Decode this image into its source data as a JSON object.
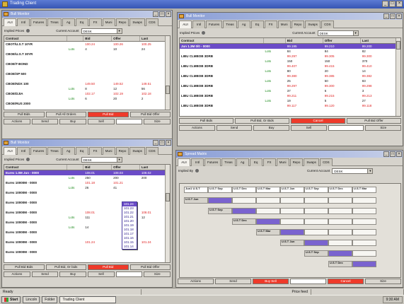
{
  "app": {
    "title": "Trading Client"
  },
  "status": {
    "left": "Ready",
    "middle": "Price feed",
    "right": ""
  },
  "taskbar": {
    "start": "Start",
    "items": [
      "Lincoln",
      "Folder",
      "Trading Client"
    ],
    "clock": "9:30 AM"
  },
  "win1": {
    "title": "Bull Monitor",
    "tabs": [
      "AUI",
      "Intl",
      "Futures",
      "Treas",
      "Ag",
      "Eq",
      "FX",
      "Muni",
      "Repo",
      "Swaps",
      "CDS"
    ],
    "implied_label": "Implied Prices",
    "account_label": "Current Account",
    "account_value": "DESK",
    "columns": [
      "Contract",
      "",
      "Bid",
      "Offer",
      "Last"
    ],
    "rows": [
      {
        "c": "CBOT/U.S.T 10YR",
        "q": "",
        "bid": "100.24",
        "offer": "100.26",
        "last": "100.25",
        "cls": "c-red"
      },
      {
        "c": "",
        "q": "Lots",
        "bid": "4",
        "offer": "10",
        "last": "24",
        "cls": ""
      },
      {
        "c": "CBOE/U.S.T 30YR",
        "q": "",
        "bid": "",
        "offer": "",
        "last": "",
        "cls": ""
      },
      {
        "c": "",
        "q": "",
        "bid": "",
        "offer": "",
        "last": "",
        "cls": ""
      },
      {
        "c": "CBOE/T-BOND",
        "q": "",
        "bid": "",
        "offer": "",
        "last": "",
        "cls": ""
      },
      {
        "c": "",
        "q": "",
        "bid": "",
        "offer": "",
        "last": "",
        "cls": ""
      },
      {
        "c": "CBOE/SP 500",
        "q": "",
        "bid": "",
        "offer": "",
        "last": "",
        "cls": ""
      },
      {
        "c": "",
        "q": "",
        "bid": "",
        "offer": "",
        "last": "",
        "cls": ""
      },
      {
        "c": "CBOE/NDX 100",
        "q": "",
        "bid": "149.50",
        "offer": "149.52",
        "last": "149.51",
        "cls": "c-red"
      },
      {
        "c": "",
        "q": "Lots",
        "bid": "8",
        "offer": "12",
        "last": "56",
        "cls": ""
      },
      {
        "c": "CBOE/DJIA",
        "q": "",
        "bid": "102.17",
        "offer": "102.19",
        "last": "102.18",
        "cls": "c-red"
      },
      {
        "c": "",
        "q": "Lots",
        "bid": "6",
        "offer": "20",
        "last": "2",
        "cls": ""
      },
      {
        "c": "CBOE/RUS 2000",
        "q": "",
        "bid": "",
        "offer": "",
        "last": "",
        "cls": ""
      }
    ],
    "footer1": [
      "Pull Bids",
      "Pull All Orders",
      "Pull Bid",
      "Pull Bid Offer"
    ],
    "footer2": [
      "Actions",
      "Send",
      "Buy",
      "Sell",
      "",
      "Size"
    ]
  },
  "win2": {
    "title": "Bull Monitor",
    "tabs": [
      "AUI",
      "Intl",
      "Futures",
      "Treas",
      "Ag",
      "Eq",
      "FX",
      "Muni",
      "Repo",
      "Swaps",
      "CDS"
    ],
    "implied_label": "Implied Prices",
    "account_label": "Current Account",
    "account_value": "DESK",
    "columns": [
      "Contract",
      "",
      "Bid",
      "Offer",
      "Last"
    ],
    "rows": [
      {
        "c": "Jun 1.3M 0/0 - 0000",
        "q": "",
        "bid": "99.195",
        "offer": "99.210",
        "last": "99.200",
        "cls": "sel"
      },
      {
        "c": "",
        "q": "Lots",
        "bid": "84",
        "offer": "84",
        "last": "82",
        "cls": ""
      },
      {
        "c": "LIBU CLMBOB 3DRB",
        "q": "",
        "bid": "99.297",
        "offer": "99.305",
        "last": "99.300",
        "cls": "c-red"
      },
      {
        "c": "",
        "q": "Lots",
        "bid": "150",
        "offer": "150",
        "last": "370",
        "cls": ""
      },
      {
        "c": "LIBU CLMBOB 3DRB",
        "q": "",
        "bid": "99.407",
        "offer": "99.415",
        "last": "99.410",
        "cls": "c-red"
      },
      {
        "c": "",
        "q": "Lots",
        "bid": "80",
        "offer": "20",
        "last": "14",
        "cls": ""
      },
      {
        "c": "LIBU CLMBOB 3DRB",
        "q": "",
        "bid": "99.380",
        "offer": "99.385",
        "last": "99.382",
        "cls": "c-red"
      },
      {
        "c": "",
        "q": "Lots",
        "bid": "25",
        "offer": "50",
        "last": "83",
        "cls": ""
      },
      {
        "c": "LIBU CLMBOB 3DRB",
        "q": "",
        "bid": "99.297",
        "offer": "99.300",
        "last": "99.298",
        "cls": "c-red"
      },
      {
        "c": "",
        "q": "Lots",
        "bid": "37",
        "offer": "6",
        "last": "3",
        "cls": ""
      },
      {
        "c": "LIBU CLMBOB 3DRB",
        "q": "",
        "bid": "99.211",
        "offer": "99.215",
        "last": "99.213",
        "cls": "c-red"
      },
      {
        "c": "",
        "q": "Lots",
        "bid": "19",
        "offer": "5",
        "last": "27",
        "cls": ""
      },
      {
        "c": "LIBU CLMBOB 3DRB",
        "q": "",
        "bid": "99.117",
        "offer": "99.120",
        "last": "99.118",
        "cls": "c-red"
      }
    ],
    "footer1": [
      "Pull Bids",
      "Pull Bid, Or Bids",
      "Cancel",
      "Pull Bid Offer"
    ],
    "footer2": [
      "Actions",
      "Send",
      "Buy",
      "Sell",
      "",
      "Size"
    ]
  },
  "win3": {
    "title": "Bull Monitor",
    "tabs": [
      "AUI",
      "Intl",
      "Futures",
      "Treas",
      "Ag",
      "Eq",
      "FX",
      "Muni",
      "Repo",
      "Swaps",
      "CDS"
    ],
    "implied_label": "Implied Prices",
    "account_label": "Current Account",
    "account_value": "DESK",
    "columns": [
      "Contract",
      "",
      "Bid",
      "Offer",
      "Last"
    ],
    "rows": [
      {
        "c": "Eurex 1.0M Jun - 0000",
        "q": "",
        "bid": "108.01",
        "offer": "108.03",
        "last": "108.02",
        "cls": "sel"
      },
      {
        "c": "",
        "q": "Lots",
        "bid": "250",
        "offer": "200",
        "last": "200",
        "cls": ""
      },
      {
        "c": "Eurex 10000M - 0000",
        "q": "",
        "bid": "101.18",
        "offer": "101.21",
        "last": "",
        "cls": "c-red"
      },
      {
        "c": "",
        "q": "Lots",
        "bid": "26",
        "offer": "41",
        "last": "",
        "cls": ""
      },
      {
        "c": "Eurex 10000M - 0000",
        "q": "",
        "bid": "",
        "offer": "",
        "last": "",
        "cls": ""
      },
      {
        "c": "",
        "q": "",
        "bid": "",
        "offer": "",
        "last": "",
        "cls": ""
      },
      {
        "c": "Eurex 10000M - 0000",
        "q": "",
        "bid": "",
        "offer": "",
        "last": "",
        "cls": ""
      },
      {
        "c": "",
        "q": "",
        "bid": "",
        "offer": "",
        "last": "",
        "cls": ""
      },
      {
        "c": "Eurex 10000M - 0000",
        "q": "",
        "bid": "108.01",
        "offer": "",
        "last": "108.01",
        "cls": "c-red"
      },
      {
        "c": "",
        "q": "Lots",
        "bid": "111",
        "offer": "",
        "last": "12",
        "cls": ""
      },
      {
        "c": "Eurex 10000M - 0000",
        "q": "",
        "bid": "",
        "offer": "",
        "last": "",
        "cls": ""
      },
      {
        "c": "",
        "q": "Lots",
        "bid": "14",
        "offer": "",
        "last": "",
        "cls": ""
      },
      {
        "c": "Eurex 10000M - 0000",
        "q": "",
        "bid": "",
        "offer": "",
        "last": "",
        "cls": ""
      },
      {
        "c": "",
        "q": "",
        "bid": "",
        "offer": "",
        "last": "",
        "cls": ""
      },
      {
        "c": "Eurex 10000M - 0000",
        "q": "",
        "bid": "101.24",
        "offer": "",
        "last": "101.24",
        "cls": "c-red"
      },
      {
        "c": "",
        "q": "",
        "bid": "",
        "offer": "",
        "last": "",
        "cls": ""
      },
      {
        "c": "Eurex 10000M - 0000",
        "q": "",
        "bid": "",
        "offer": "",
        "last": "",
        "cls": ""
      }
    ],
    "dropdown": [
      "101.24",
      "101.23",
      "101.22",
      "101.21",
      "101.20",
      "101.19",
      "101.18",
      "101.17",
      "101.16",
      "101.15",
      "101.14"
    ],
    "footer1": [
      "Pull Bid Bids",
      "Pull Bid, Or bids",
      "Pull Bid",
      "Pull Bid Offer"
    ],
    "footer2": [
      "Actions",
      "Send",
      "Buy",
      "Sell",
      "",
      "Size"
    ]
  },
  "win4": {
    "title": "Spread Matrix",
    "tabs": [
      "AUI",
      "Intl",
      "Futures",
      "Treas",
      "Ag",
      "Eq",
      "FX",
      "Muni",
      "Repo",
      "Swaps",
      "CDS"
    ],
    "implied_label": "Implied By",
    "account_label": "Current Account",
    "account_value": "DESK",
    "col_headers": [
      "Jun1 U.S.T",
      "U.S.T Sep",
      "U.S.T Dec",
      "U.S.T Mar",
      "U.S.T Jun",
      "U.S.T Sep",
      "U.S.T Dec",
      "U.S.T Mar"
    ],
    "row_headers": [
      "U.S.T Jun",
      "U.S.T Sep",
      "U.S.T Dec",
      "U.S.T Mar",
      "U.S.T Jun",
      "U.S.T Sep",
      "U.S.T Dec"
    ],
    "cells": [
      [
        "+0.00",
        "",
        "",
        "",
        "",
        "",
        "",
        ""
      ],
      [
        "+0.05",
        "+0.12",
        "",
        "",
        "",
        "",
        "",
        ""
      ],
      [
        "+0.10",
        "+0.15",
        "+0.18",
        "",
        "",
        "",
        "",
        ""
      ],
      [
        "+0.14",
        "+0.20",
        "+0.24",
        "+0.26",
        "",
        "",
        "",
        ""
      ],
      [
        "+0.18",
        "+0.25",
        "+0.30",
        "+0.33",
        "+0.35",
        "",
        "",
        ""
      ],
      [
        "+0.22",
        "+0.30",
        "+0.35",
        "+0.38",
        "+0.41",
        "+0.44",
        "",
        ""
      ],
      [
        "+0.27",
        "+0.35",
        "+0.40",
        "+0.44",
        "+0.47",
        "+0.50",
        "+0.53",
        ""
      ]
    ],
    "footer": [
      "Actions",
      "Send",
      "Buy Sell",
      "",
      "Cancel",
      "Size"
    ]
  }
}
